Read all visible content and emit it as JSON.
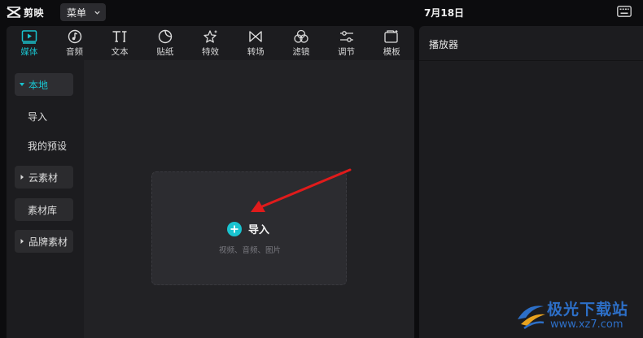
{
  "titlebar": {
    "logo_text": "剪映",
    "menu_label": "菜单",
    "window_title": "7月18日"
  },
  "toolbar": {
    "tabs": [
      {
        "label": "媒体",
        "icon": "media-icon",
        "active": true
      },
      {
        "label": "音频",
        "icon": "audio-icon",
        "active": false
      },
      {
        "label": "文本",
        "icon": "text-icon",
        "active": false
      },
      {
        "label": "贴纸",
        "icon": "sticker-icon",
        "active": false
      },
      {
        "label": "特效",
        "icon": "effects-icon",
        "active": false
      },
      {
        "label": "转场",
        "icon": "transition-icon",
        "active": false
      },
      {
        "label": "滤镜",
        "icon": "filter-icon",
        "active": false
      },
      {
        "label": "调节",
        "icon": "adjust-icon",
        "active": false
      },
      {
        "label": "模板",
        "icon": "template-icon",
        "active": false
      }
    ]
  },
  "sidebar": {
    "items": [
      {
        "label": "本地"
      },
      {
        "label": "导入"
      },
      {
        "label": "我的预设"
      },
      {
        "label": "云素材"
      },
      {
        "label": "素材库"
      },
      {
        "label": "品牌素材"
      }
    ]
  },
  "import": {
    "label": "导入",
    "hint": "视频、音频、图片"
  },
  "player": {
    "title": "播放器"
  },
  "watermark": {
    "title": "极光下载站",
    "url": "www.xz7.com"
  },
  "colors": {
    "accent": "#19c3cf",
    "arrow": "#e01b1b",
    "watermark": "#2d6fc7"
  }
}
